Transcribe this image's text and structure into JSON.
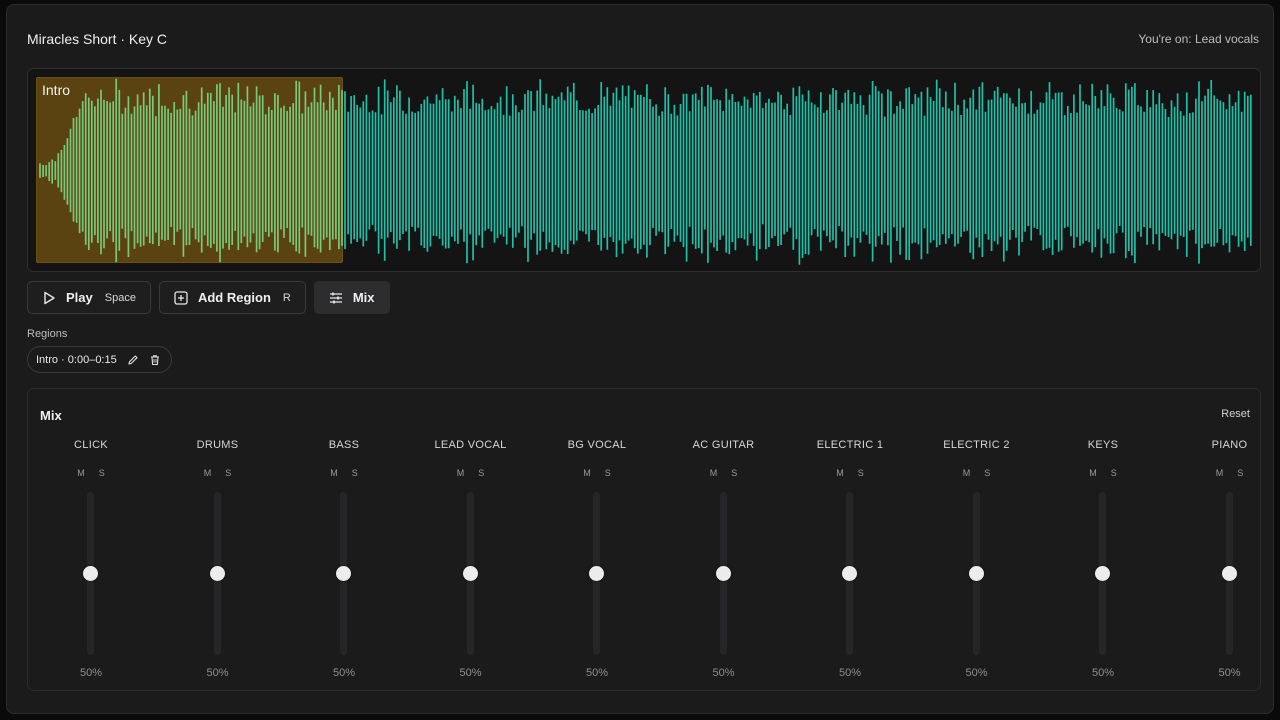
{
  "header": {
    "title": "Miracles Short · Key C",
    "context": "You're on: Lead vocals"
  },
  "waveform": {
    "region_label": "Intro",
    "colors": {
      "region_bg": "#5a4211",
      "region_wave": "#79c979",
      "wave": "#1fbfa8"
    }
  },
  "toolbar": {
    "play": {
      "label": "Play",
      "shortcut": "Space",
      "icon": "play-icon"
    },
    "add_region": {
      "label": "Add Region",
      "shortcut": "R",
      "icon": "plus-square-icon"
    },
    "mix": {
      "label": "Mix",
      "icon": "sliders-icon",
      "active": true
    }
  },
  "regions": {
    "label": "Regions",
    "items": [
      {
        "label": "Intro · 0:00–0:15",
        "edit_icon": "pencil-icon",
        "delete_icon": "trash-icon"
      }
    ]
  },
  "mix": {
    "title": "Mix",
    "reset_label": "Reset",
    "mute_label": "M",
    "solo_label": "S",
    "channels": [
      {
        "name": "CLICK",
        "value": "50%",
        "level": 0.5
      },
      {
        "name": "DRUMS",
        "value": "50%",
        "level": 0.5
      },
      {
        "name": "BASS",
        "value": "50%",
        "level": 0.5
      },
      {
        "name": "LEAD VOCAL",
        "value": "50%",
        "level": 0.5
      },
      {
        "name": "BG VOCAL",
        "value": "50%",
        "level": 0.5
      },
      {
        "name": "AC GUITAR",
        "value": "50%",
        "level": 0.5
      },
      {
        "name": "ELECTRIC 1",
        "value": "50%",
        "level": 0.5
      },
      {
        "name": "ELECTRIC 2",
        "value": "50%",
        "level": 0.5
      },
      {
        "name": "KEYS",
        "value": "50%",
        "level": 0.5
      },
      {
        "name": "PIANO",
        "value": "50%",
        "level": 0.5
      }
    ]
  }
}
